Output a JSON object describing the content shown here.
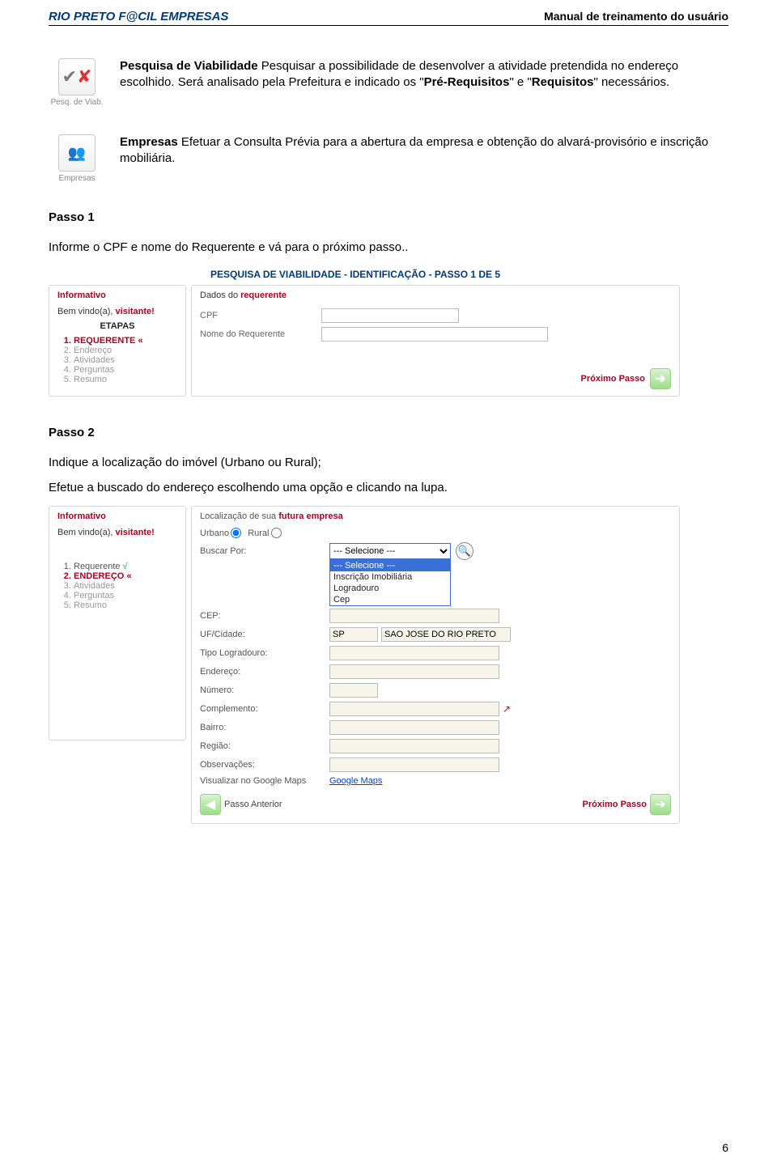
{
  "header": {
    "left": "RIO PRETO F@CIL EMPRESAS",
    "right": "Manual de treinamento do usuário"
  },
  "block1": {
    "icon_caption": "Pesq. de Viab.",
    "html_parts": {
      "a": "Pesquisa de Viabilidade",
      "b": " Pesquisar a possibilidade de desenvolver a atividade pretendida no endereço escolhido. Será analisado pela Prefeitura e indicado os \"",
      "c": "Pré-Requisitos",
      "d": "\" e \"",
      "e": "Requisitos",
      "f": "\" necessários."
    }
  },
  "block2": {
    "icon_caption": "Empresas",
    "html_parts": {
      "a": "Empresas",
      "b": " Efetuar a Consulta Prévia para a abertura da empresa e obtenção do alvará-provisório e inscrição mobiliária."
    }
  },
  "passo1": {
    "title": "Passo 1",
    "text": "Informe o CPF e nome do Requerente  e vá para o próximo passo.."
  },
  "shot1": {
    "title": "PESQUISA DE VIABILIDADE - IDENTIFICAÇÃO - PASSO 1 DE 5",
    "side": {
      "informativo": "Informativo",
      "welcome_pre": "Bem vindo(a), ",
      "welcome_vis": "visitante!",
      "etapas": "ETAPAS",
      "steps": [
        "REQUERENTE «",
        "Endereço",
        "Atividades",
        "Perguntas",
        "Resumo"
      ]
    },
    "main": {
      "hdr_pre": "Dados do ",
      "hdr_req": "requerente",
      "cpf_label": "CPF",
      "nome_label": "Nome do Requerente",
      "next_label": "Próximo Passo"
    }
  },
  "passo2": {
    "title": "Passo 2",
    "line1": "Indique a localização do imóvel (Urbano ou Rural);",
    "line2": "Efetue a buscado do endereço escolhendo uma opção e clicando na lupa."
  },
  "shot2": {
    "side": {
      "informativo": "Informativo",
      "welcome_pre": "Bem vindo(a), ",
      "welcome_vis": "visitante!",
      "steps": [
        "Requerente",
        "ENDEREÇO «",
        "Atividades",
        "Perguntas",
        "Resumo"
      ]
    },
    "main": {
      "hdr_pre": "Localização de sua ",
      "hdr_fut": "futura empresa",
      "urbano": "Urbano",
      "rural": "Rural",
      "buscar_por": "Buscar Por:",
      "select_value": "--- Selecione ---",
      "dropdown_options": [
        "--- Selecione ---",
        "Inscrição Imobiliária",
        "Logradouro",
        "Cep"
      ],
      "labels": {
        "cep": "CEP:",
        "uf_cidade": "UF/Cidade:",
        "tipo_log": "Tipo Logradouro:",
        "endereco": "Endereço:",
        "numero": "Número:",
        "complemento": "Complemento:",
        "bairro": "Bairro:",
        "regiao": "Região:",
        "obs": "Observações:",
        "gmaps": "Visualizar no Google Maps"
      },
      "uf_value": "SP",
      "city_value": "SAO JOSE DO RIO PRETO",
      "gmaps_link": "Google Maps",
      "prev_label": "Passo Anterior",
      "next_label": "Próximo Passo"
    }
  },
  "page_number": "6"
}
